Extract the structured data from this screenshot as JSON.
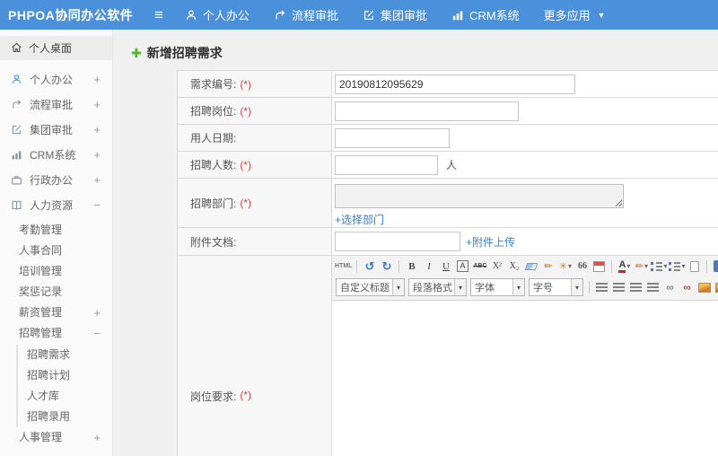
{
  "topbar": {
    "logo": "PHPOA协同办公软件",
    "nav": [
      {
        "label": "个人办公"
      },
      {
        "label": "流程审批"
      },
      {
        "label": "集团审批"
      },
      {
        "label": "CRM系统"
      },
      {
        "label": "更多应用"
      }
    ]
  },
  "sidebar": {
    "desktop": "个人桌面",
    "items": [
      {
        "label": "个人办公",
        "expand": "+"
      },
      {
        "label": "流程审批",
        "expand": "+"
      },
      {
        "label": "集团审批",
        "expand": "+"
      },
      {
        "label": "CRM系统",
        "expand": "+"
      },
      {
        "label": "行政办公",
        "expand": "+"
      },
      {
        "label": "人力资源",
        "expand": "−"
      }
    ],
    "hr_children": [
      {
        "label": "考勤管理",
        "expand": ""
      },
      {
        "label": "人事合同",
        "expand": ""
      },
      {
        "label": "培训管理",
        "expand": ""
      },
      {
        "label": "奖惩记录",
        "expand": ""
      },
      {
        "label": "薪资管理",
        "expand": "+"
      },
      {
        "label": "招聘管理",
        "expand": "−"
      }
    ],
    "recruit_children": [
      {
        "label": "招聘需求"
      },
      {
        "label": "招聘计划"
      },
      {
        "label": "人才库"
      },
      {
        "label": "招聘录用"
      }
    ],
    "bottom_item": {
      "label": "人事管理",
      "expand": "+"
    }
  },
  "main": {
    "title": "新增招聘需求",
    "form": {
      "required_mark": "(*)",
      "demand_no": {
        "label": "需求编号:",
        "value": "20190812095629"
      },
      "position": {
        "label": "招聘岗位:",
        "value": ""
      },
      "hire_date": {
        "label": "用人日期:",
        "value": ""
      },
      "headcount": {
        "label": "招聘人数:",
        "suffix": "人",
        "value": ""
      },
      "department": {
        "label": "招聘部门:",
        "link": "+选择部门"
      },
      "attachment": {
        "label": "附件文档:",
        "link": "+附件上传",
        "value": ""
      },
      "requirements": {
        "label": "岗位要求:"
      }
    }
  },
  "editor": {
    "selects": [
      {
        "label": "自定义标题"
      },
      {
        "label": "段落格式"
      },
      {
        "label": "字体"
      },
      {
        "label": "字号"
      }
    ]
  },
  "icons": {
    "hamburger": "≡",
    "caret_down": "▼",
    "caret_small": "▾",
    "add_plus": "✚",
    "html": "HTML",
    "undo": "↺",
    "redo": "↻",
    "bold": "B",
    "italic": "I",
    "underline": "U",
    "font_frame": "A",
    "strike": "ABC",
    "superscript": "X²",
    "subscript": "X₂",
    "brush": "✏",
    "wand": "✳",
    "quote": "66",
    "font_color": "A",
    "link": "∞",
    "unlink": "∞",
    "play": "▸"
  },
  "colors": {
    "topbar_blue": "#4a90da",
    "link_blue": "#3b7fd4",
    "required_red": "#e84040",
    "title_green": "#56b52f",
    "editor_accent": "#4a90da"
  }
}
